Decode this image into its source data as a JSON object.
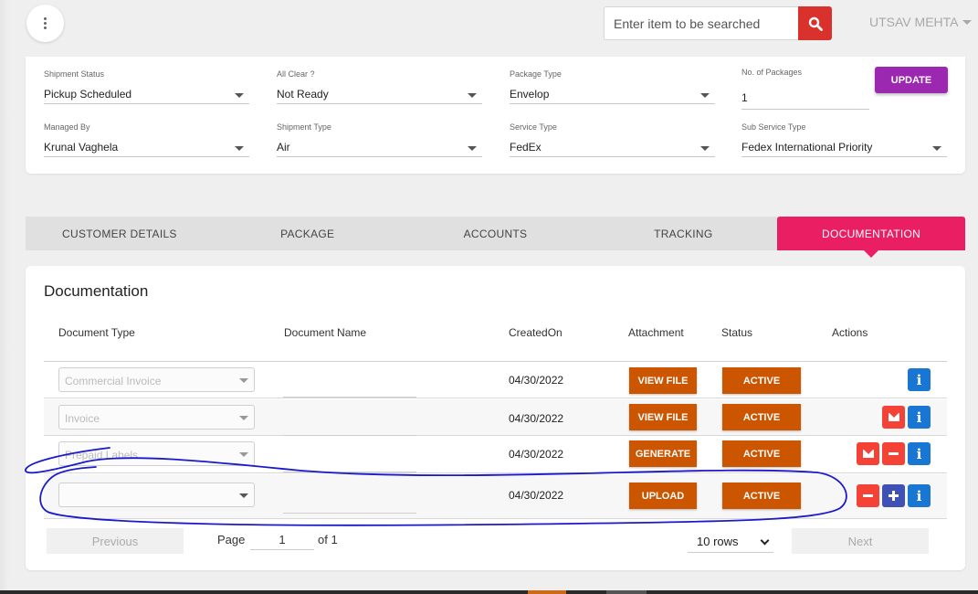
{
  "header": {
    "search_placeholder": "Enter item to be searched",
    "user_name": "UTSAV MEHTA"
  },
  "shipment": {
    "fields": [
      {
        "label": "Shipment Status",
        "value": "Pickup Scheduled"
      },
      {
        "label": "All Clear ?",
        "value": "Not Ready"
      },
      {
        "label": "Package Type",
        "value": "Envelop"
      },
      {
        "label": "No. of Packages",
        "value": "1"
      },
      {
        "label": "Managed By",
        "value": "Krunal Vaghela"
      },
      {
        "label": "Shipment Type",
        "value": "Air"
      },
      {
        "label": "Service Type",
        "value": "FedEx"
      },
      {
        "label": "Sub Service Type",
        "value": "Fedex International Priority"
      }
    ],
    "update_label": "UPDATE"
  },
  "tabs": [
    {
      "label": "CUSTOMER DETAILS"
    },
    {
      "label": "PACKAGE"
    },
    {
      "label": "ACCOUNTS"
    },
    {
      "label": "TRACKING"
    },
    {
      "label": "DOCUMENTATION",
      "active": true
    }
  ],
  "documentation": {
    "title": "Documentation",
    "columns": [
      "Document Type",
      "Document Name",
      "CreatedOn",
      "Attachment",
      "Status",
      "Actions"
    ],
    "rows": [
      {
        "type": "Commercial Invoice",
        "name": "",
        "created": "04/30/2022",
        "attachment": "VIEW FILE",
        "status": "ACTIVE"
      },
      {
        "type": "Invoice",
        "name": "",
        "created": "04/30/2022",
        "attachment": "VIEW FILE",
        "status": "ACTIVE"
      },
      {
        "type": "Prepaid Labels",
        "name": "",
        "created": "04/30/2022",
        "attachment": "GENERATE",
        "status": "ACTIVE"
      },
      {
        "type": "",
        "name": "",
        "created": "04/30/2022",
        "attachment": "UPLOAD",
        "status": "ACTIVE"
      }
    ]
  },
  "pagination": {
    "previous_label": "Previous",
    "page_label": "Page",
    "page_value": "1",
    "of_label": "of 1",
    "rows_label": "10 rows",
    "next_label": "Next"
  },
  "colors": {
    "accent_pink": "#e91e63",
    "update_purple": "#9c27b0",
    "action_orange": "#cc5500",
    "search_red": "#d9322c",
    "annotation_blue": "#1a1acc"
  }
}
